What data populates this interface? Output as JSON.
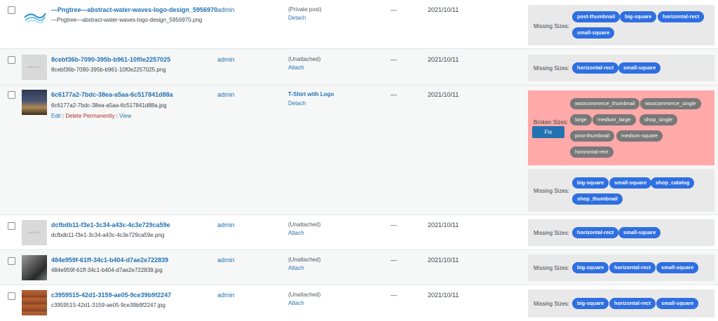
{
  "rows": [
    {
      "title": "—Pngtree—abstract-water-waves-logo-design_5956970",
      "file": "—Pngtree—abstract-water-waves-logo-design_5956970.png",
      "author": "admin",
      "uploaded_to": "(Private post)",
      "attach_action": "Detach",
      "dash": "—",
      "date": "2021/10/11",
      "missing_label": "Missing Sizes:",
      "missing": [
        "post-thumbnail",
        "big-square",
        "horizontal-rect",
        "small-square"
      ]
    },
    {
      "title": "8cebf36b-7090-395b-b961-10f0e2257025",
      "file": "8cebf36b-7090-395b-b961-10f0e2257025.png",
      "author": "admin",
      "uploaded_to": "(Unattached)",
      "attach_action": "Attach",
      "dash": "—",
      "date": "2021/10/11",
      "missing_label": "Missing Sizes:",
      "missing": [
        "horizontal-rect",
        "small-square"
      ]
    },
    {
      "title": "6c6177a2-7bdc-38ea-a5aa-6c517841d88a",
      "file": "6c6177a2-7bdc-38ea-a5aa-6c517841d88a.jpg",
      "actions": {
        "edit": "Edit",
        "sep": "|",
        "delete": "Delete Permanently",
        "view": "View"
      },
      "author": "admin",
      "uploaded_to": "T-Shirt with Logo",
      "attach_action": "Detach",
      "dash": "—",
      "date": "2021/10/11",
      "broken_label": "Broken Sizes:",
      "fix_label": "Fix",
      "broken": [
        "woocommerce_thumbnail",
        "woocommerce_single",
        "large",
        "medium_large",
        "shop_single",
        "post-thumbnail",
        "medium-square",
        "horizontal-rect"
      ],
      "missing_label": "Missing Sizes:",
      "missing": [
        "big-square",
        "small-square",
        "shop_catalog",
        "shop_thumbnail"
      ]
    },
    {
      "title": "dcfbdb11-f3e1-3c34-a43c-4c3e729ca59e",
      "file": "dcfbdb11-f3e1-3c34-a43c-4c3e729ca59e.png",
      "author": "admin",
      "uploaded_to": "(Unattached)",
      "attach_action": "Attach",
      "dash": "—",
      "date": "2021/10/11",
      "missing_label": "Missing Sizes:",
      "missing": [
        "horizontal-rect",
        "small-square"
      ]
    },
    {
      "title": "484e959f-61ff-34c1-b404-d7ae2e722839",
      "file": "484e959f-61ff-34c1-b404-d7ae2e722839.jpg",
      "author": "admin",
      "uploaded_to": "(Unattached)",
      "attach_action": "Attach",
      "dash": "—",
      "date": "2021/10/11",
      "missing_label": "Missing Sizes:",
      "missing": [
        "big-square",
        "horizontal-rect",
        "small-square"
      ]
    },
    {
      "title": "c3959515-42d1-3159-ae05-9ce39b9f2247",
      "file": "c3959515-42d1-3159-ae05-9ce39b9f2247.jpg",
      "author": "admin",
      "uploaded_to": "(Unattached)",
      "attach_action": "Attach",
      "dash": "—",
      "date": "2021/10/11",
      "missing_label": "Missing Sizes:",
      "missing": [
        "big-square",
        "horizontal-rect",
        "small-square"
      ]
    }
  ],
  "placeholder_text": "640 x 270",
  "colors": {
    "link": "#2271b1",
    "pill_blue": "#2f6fe0",
    "pill_grey": "#787878",
    "broken_bg": "#ffa9a9",
    "box_bg": "#e9e9e9",
    "delete": "#b32d2e"
  }
}
